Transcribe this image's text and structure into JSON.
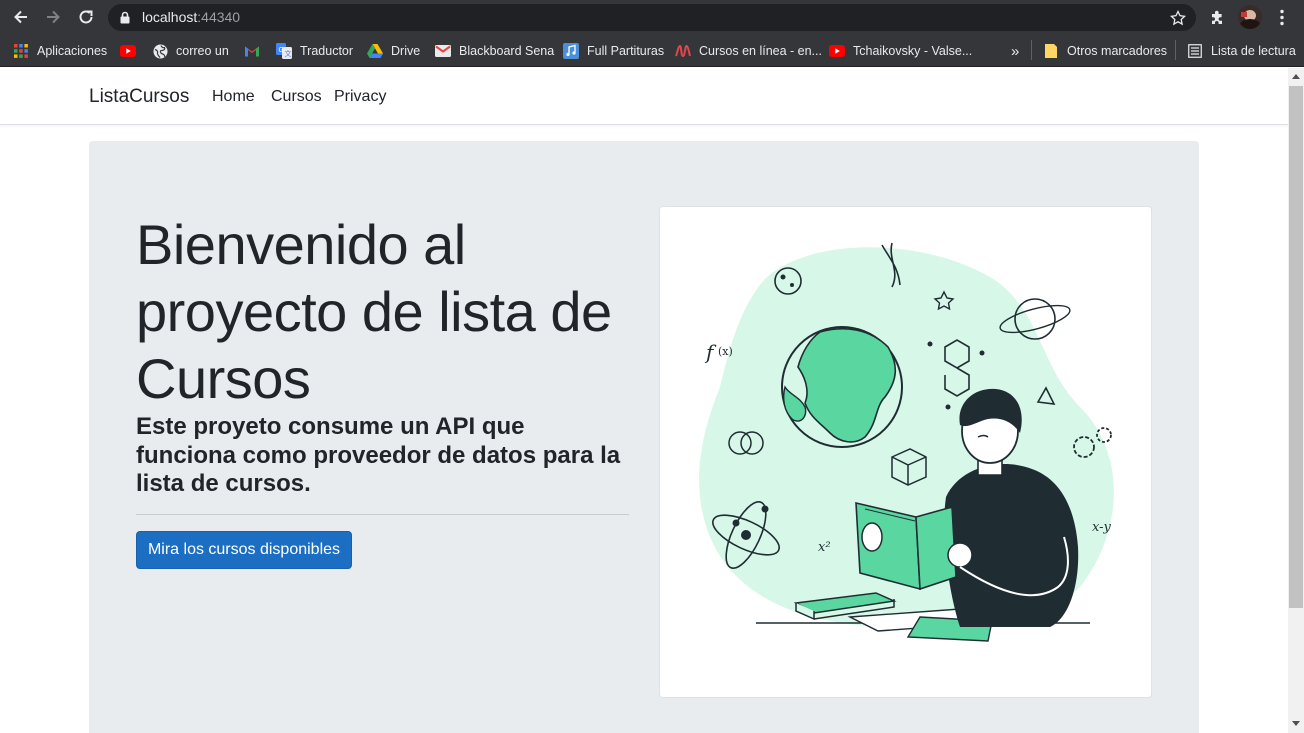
{
  "browser": {
    "url_host": "localhost",
    "url_port": ":44340",
    "bookmarks": [
      {
        "label": "Aplicaciones",
        "icon": "apps-grid-icon"
      },
      {
        "label": "",
        "icon": "youtube-icon"
      },
      {
        "label": "correo un",
        "icon": "globe-icon"
      },
      {
        "label": "",
        "icon": "gmail-icon"
      },
      {
        "label": "Traductor",
        "icon": "translate-icon"
      },
      {
        "label": "Drive",
        "icon": "drive-icon"
      },
      {
        "label": "Blackboard Sena",
        "icon": "gmail-icon"
      },
      {
        "label": "Full Partituras",
        "icon": "music-icon"
      },
      {
        "label": "Cursos en línea - en...",
        "icon": "wave-icon"
      },
      {
        "label": "Tchaikovsky - Valse...",
        "icon": "youtube-icon"
      }
    ],
    "overflow": "»",
    "other_bookmarks": "Otros marcadores",
    "reading_list": "Lista de lectura"
  },
  "nav": {
    "brand": "ListaCursos",
    "links": [
      "Home",
      "Cursos",
      "Privacy"
    ]
  },
  "hero": {
    "title": "Bienvenido al proyecto de lista de Cursos",
    "subtitle": "Este proyeto consume un API que funciona como proveedor de datos para la lista de cursos.",
    "cta": "Mira los cursos disponibles"
  },
  "colors": {
    "primary": "#1b6ec2",
    "jumbotron": "#e9ecef",
    "illustration_green": "#5ad6a0",
    "illustration_mint": "#d7f7e8",
    "illustration_dark": "#1f2d33"
  }
}
